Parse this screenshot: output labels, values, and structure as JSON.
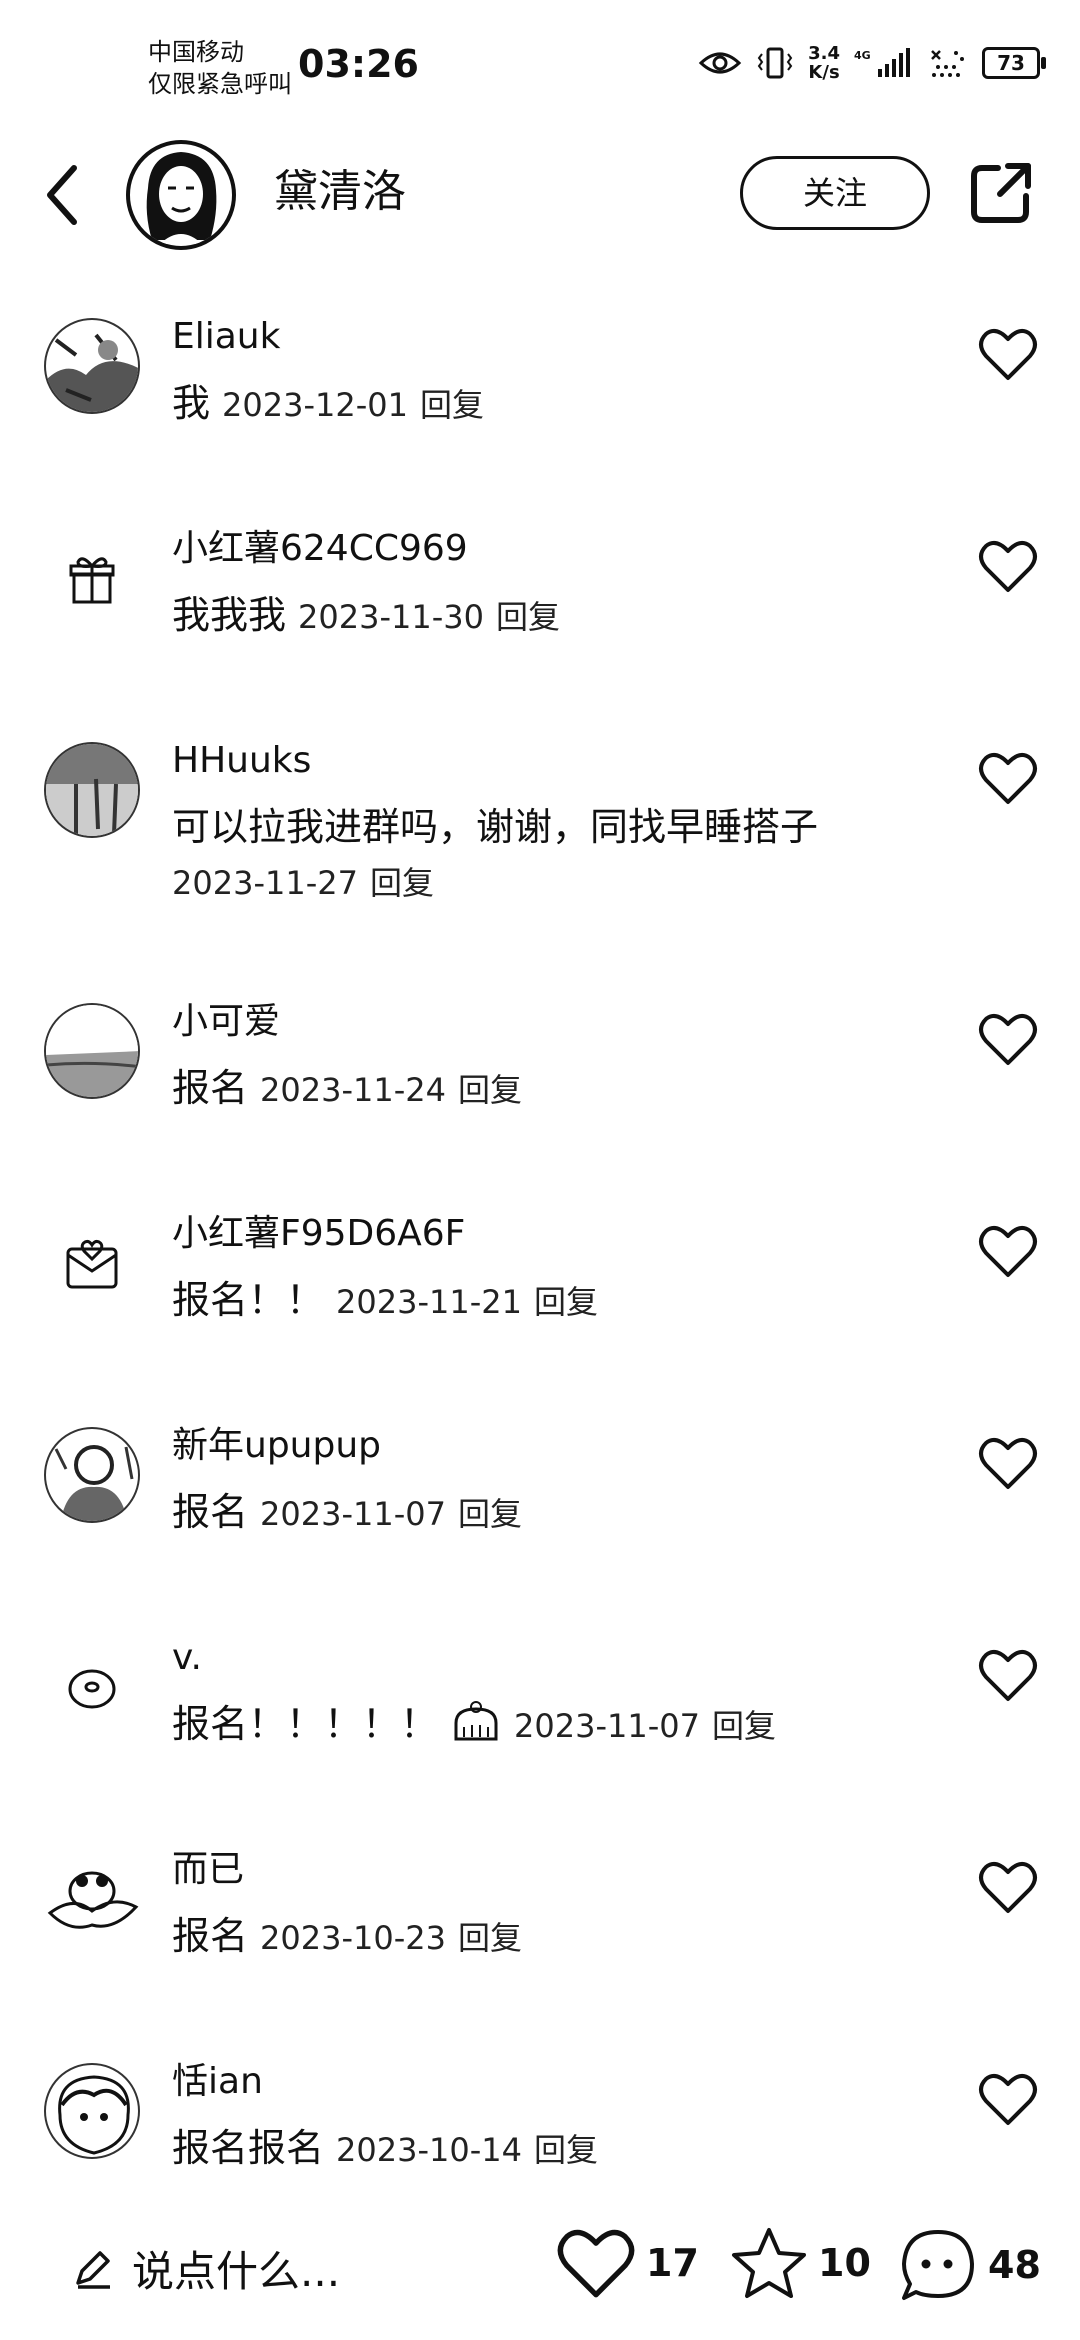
{
  "status_bar": {
    "carrier_line1": "中国移动",
    "carrier_line2": "仅限紧急呼叫",
    "time": "03:26",
    "speed_value": "3.4",
    "speed_unit": "K/s",
    "network": "4G",
    "battery": "73",
    "icons": [
      "eye-icon",
      "vibrate-icon",
      "signal-icon",
      "wifi-icon",
      "battery-icon"
    ]
  },
  "header": {
    "author_name": "黛清洛",
    "follow_label": "关注",
    "icons": [
      "back-icon",
      "share-icon"
    ]
  },
  "comments": [
    {
      "user": "Eliauk",
      "text": "我",
      "date": "2023-12-01",
      "reply": "回复",
      "avatar": "photo"
    },
    {
      "user": "小红薯624CC969",
      "text": "我我我",
      "date": "2023-11-30",
      "reply": "回复",
      "avatar": "gift-icon"
    },
    {
      "user": "HHuuks",
      "text": "可以拉我进群吗，谢谢，同找早睡搭子",
      "date": "2023-11-27",
      "reply": "回复",
      "avatar": "photo"
    },
    {
      "user": "小可爱",
      "text": "报名",
      "date": "2023-11-24",
      "reply": "回复",
      "avatar": "photo"
    },
    {
      "user": "小红薯F95D6A6F",
      "text": "报名！！",
      "date": "2023-11-21",
      "reply": "回复",
      "avatar": "mail-heart-icon"
    },
    {
      "user": "新年upupup",
      "text": "报名",
      "date": "2023-11-07",
      "reply": "回复",
      "avatar": "photo"
    },
    {
      "user": "v.",
      "text": "报名！！！！！",
      "emoji": "sticker-icon",
      "date": "2023-11-07",
      "reply": "回复",
      "avatar": "donut-icon"
    },
    {
      "user": "而已",
      "text": "报名",
      "date": "2023-10-23",
      "reply": "回复",
      "avatar": "photo"
    },
    {
      "user": "恬ian",
      "text": "报名报名",
      "date": "2023-10-14",
      "reply": "回复",
      "avatar": "photo"
    }
  ],
  "bottom_bar": {
    "input_placeholder": "说点什么...",
    "likes": "17",
    "favorites": "10",
    "comments": "48",
    "icons": [
      "pencil-icon",
      "heart-icon",
      "star-icon",
      "comment-icon"
    ]
  }
}
